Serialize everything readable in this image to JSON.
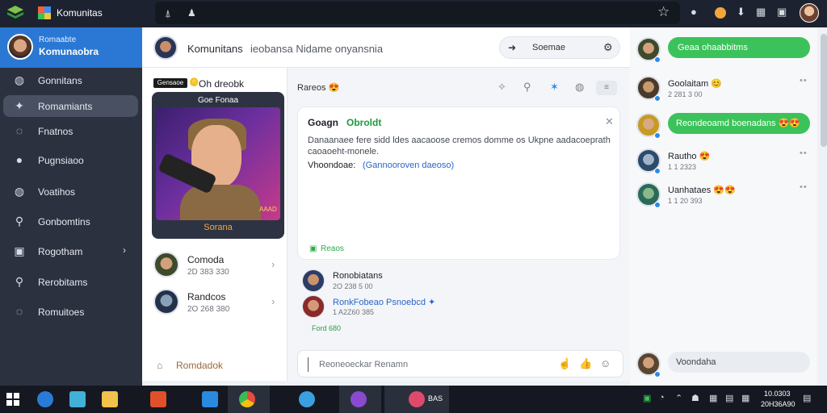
{
  "browser": {
    "title": "Komunitas",
    "address_glyphs": [
      "⍋",
      "♟"
    ],
    "colors": {
      "bar": "#1d2230",
      "address": "#14181f"
    }
  },
  "sidebar": {
    "profile": {
      "line1": "Romaabte",
      "line2": "Komunaobra"
    },
    "items": [
      {
        "label": "Gonnitans",
        "icon": "globe-icon",
        "glyph": "◍",
        "active": false
      },
      {
        "label": "Romamiants",
        "icon": "gamepad-icon",
        "glyph": "✦",
        "active": true
      },
      {
        "label": "Fnatnos",
        "icon": "pin-icon",
        "glyph": "◌",
        "active": false
      },
      {
        "label": "Pugnsiaoo",
        "icon": "user-icon",
        "glyph": "●",
        "active": false
      },
      {
        "label": "Voatihos",
        "icon": "globe-icon",
        "glyph": "◍",
        "active": false
      },
      {
        "label": "Gonbomtins",
        "icon": "search-user-icon",
        "glyph": "⚲",
        "active": false
      },
      {
        "label": "Rogotham",
        "icon": "grid-icon",
        "glyph": "▣",
        "active": false,
        "chevron": "›"
      },
      {
        "label": "Rerobitams",
        "icon": "search-icon",
        "glyph": "⚲",
        "active": false
      },
      {
        "label": "Romuitoes",
        "icon": "chat-icon",
        "glyph": "◌",
        "active": false
      }
    ],
    "colors": {
      "bg": "#2c3140",
      "profile": "#2a78d4",
      "active": "#495061"
    }
  },
  "header": {
    "title": "Komunitans",
    "subtitle": "ieobansa Nidame onyansnia",
    "search_label": "Soemae"
  },
  "midcol": {
    "badge": "Gensaoe",
    "title": "Oh dreobk",
    "card": {
      "title": "Goe Fonaa",
      "tag": "AAAD",
      "button": "Sorana"
    },
    "list": [
      {
        "name": "Comoda",
        "meta": "2D 383 330"
      },
      {
        "name": "Randcos",
        "meta": "2O 268 380"
      }
    ],
    "footer": "Romdadok"
  },
  "main": {
    "label": "Rareos 😍",
    "post": {
      "title": "Goagn",
      "title_green": "Obroldt",
      "body": "Danaanaee fere sidd ldes aacaoose cremos domme os Ukpne aadacoeprath caoaoeht-monele.",
      "label": "Vhoondoae:",
      "link": "(Gannooroven daeoso)",
      "replies": "Reaos"
    },
    "comments": [
      {
        "name": "Ronobiatans",
        "meta": "2O 238 5 00"
      },
      {
        "name": "RonkFobeao Psnoebcd ✦",
        "meta": "1 A2Z60 385"
      }
    ],
    "reply_line": "Ford 680",
    "composer_placeholder": "Reoneoeckar Renamn"
  },
  "rail": {
    "items": [
      {
        "pill": "Geaa ohaabbitms",
        "pill_color": "#3cc25a"
      },
      {
        "name": "Goolaitam 😊",
        "meta": "2 281 3 00"
      },
      {
        "pill": "Reondeoamd boenadans 😍😍",
        "pill_color": "#3cc25a"
      },
      {
        "name": "Rautho 😍",
        "meta": "1 1 2323"
      },
      {
        "name": "Uanhataes 😍😍",
        "meta": "1 1 20 393"
      }
    ],
    "bottom_pill": "Voondaha"
  },
  "taskbar": {
    "time": "10.0303",
    "date": "20H36A90",
    "active_label": "BAS"
  }
}
